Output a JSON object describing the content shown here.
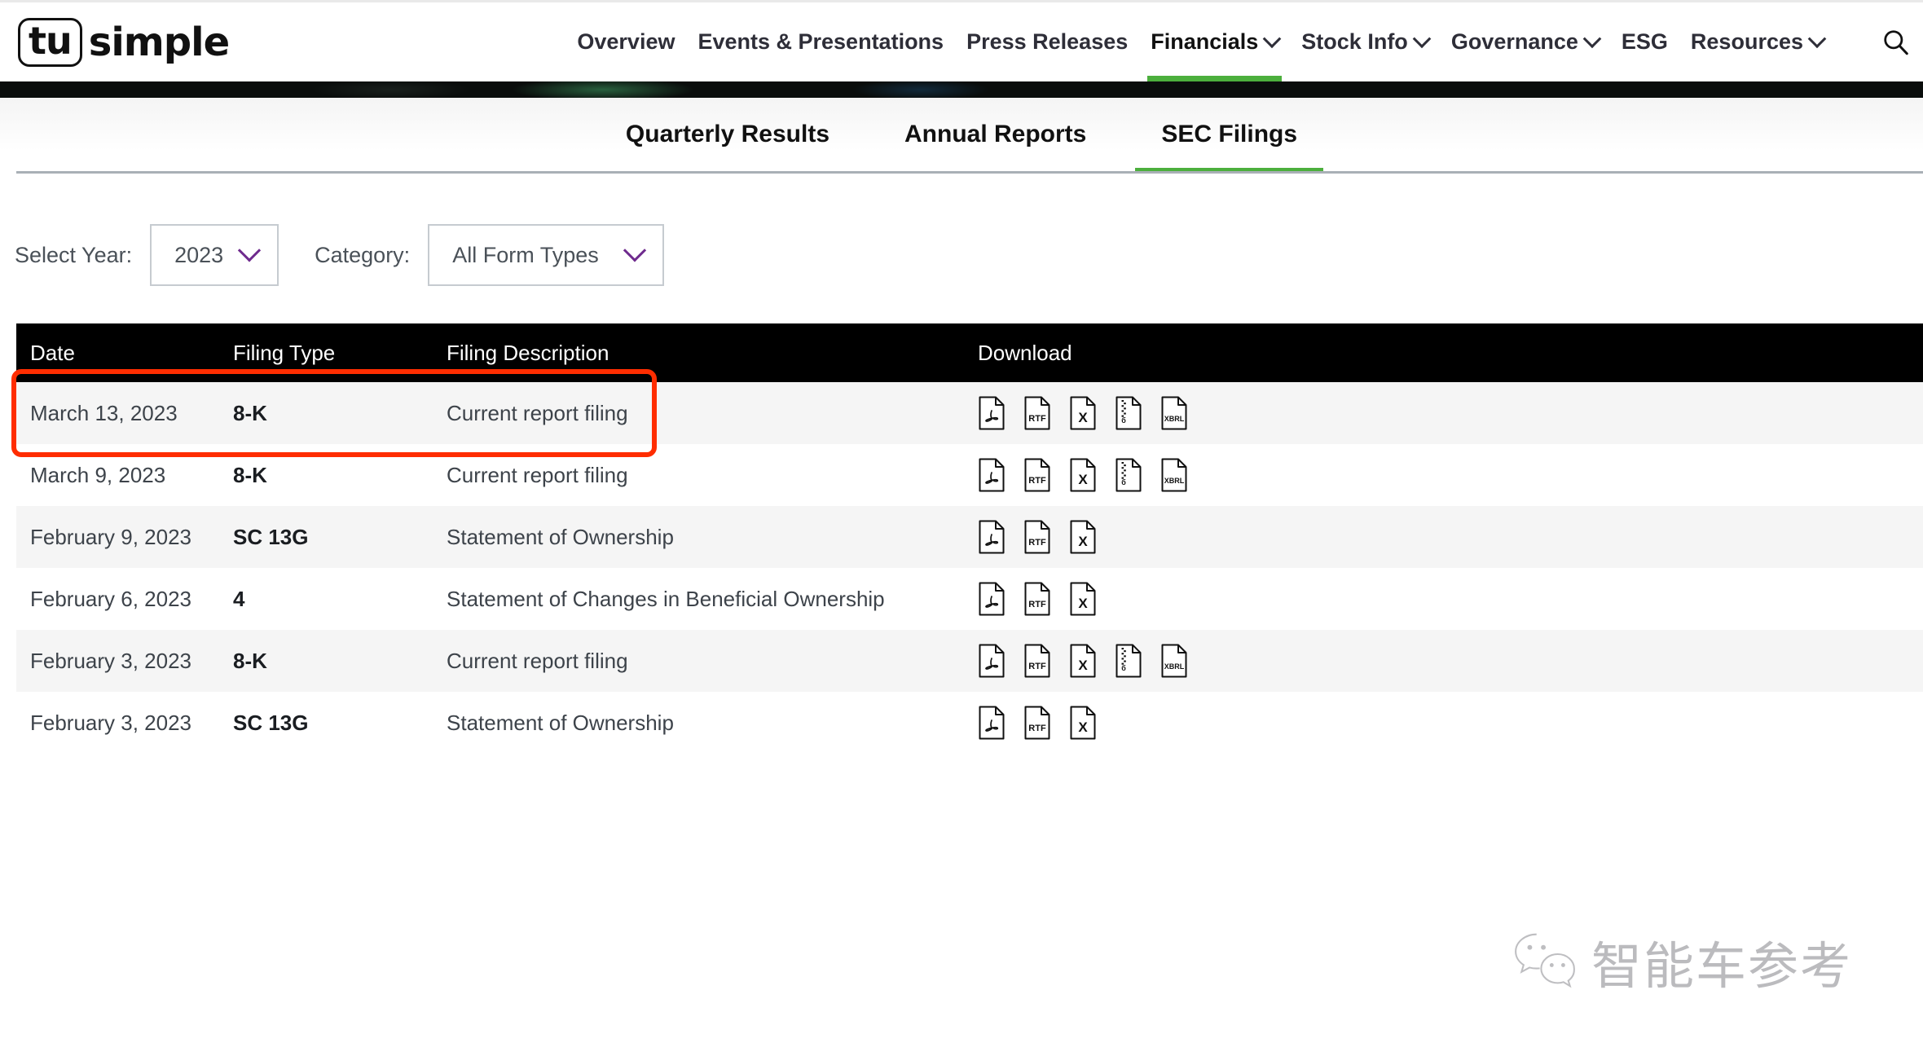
{
  "brand": {
    "logo_box_text": "tu",
    "logo_word": "simple"
  },
  "nav": {
    "items": [
      {
        "label": "Overview",
        "chevron": false,
        "active": false
      },
      {
        "label": "Events & Presentations",
        "chevron": false,
        "active": false
      },
      {
        "label": "Press Releases",
        "chevron": false,
        "active": false
      },
      {
        "label": "Financials",
        "chevron": true,
        "active": true
      },
      {
        "label": "Stock Info",
        "chevron": true,
        "active": false
      },
      {
        "label": "Governance",
        "chevron": true,
        "active": false
      },
      {
        "label": "ESG",
        "chevron": false,
        "active": false
      },
      {
        "label": "Resources",
        "chevron": true,
        "active": false
      }
    ],
    "search_icon": "search-icon",
    "active_accent": "#4caf3d"
  },
  "subtabs": {
    "items": [
      {
        "label": "Quarterly Results",
        "active": false
      },
      {
        "label": "Annual Reports",
        "active": false
      },
      {
        "label": "SEC Filings",
        "active": true
      }
    ]
  },
  "filters": {
    "year_label": "Select Year:",
    "year_value": "2023",
    "category_label": "Category:",
    "category_value": "All Form Types",
    "chevron_color": "#6f2b8e"
  },
  "table": {
    "headers": {
      "date": "Date",
      "filing_type": "Filing Type",
      "filing_description": "Filing Description",
      "download": "Download"
    },
    "rows": [
      {
        "date": "March 13, 2023",
        "filing_type": "8-K",
        "filing_description": "Current report filing",
        "downloads": [
          "PDF",
          "RTF",
          "X",
          "ZIP",
          "XBRL"
        ],
        "highlighted": true
      },
      {
        "date": "March 9, 2023",
        "filing_type": "8-K",
        "filing_description": "Current report filing",
        "downloads": [
          "PDF",
          "RTF",
          "X",
          "ZIP",
          "XBRL"
        ],
        "highlighted": false
      },
      {
        "date": "February 9, 2023",
        "filing_type": "SC 13G",
        "filing_description": "Statement of Ownership",
        "downloads": [
          "PDF",
          "RTF",
          "X"
        ],
        "highlighted": false
      },
      {
        "date": "February 6, 2023",
        "filing_type": "4",
        "filing_description": "Statement of Changes in Beneficial Ownership",
        "downloads": [
          "PDF",
          "RTF",
          "X"
        ],
        "highlighted": false
      },
      {
        "date": "February 3, 2023",
        "filing_type": "8-K",
        "filing_description": "Current report filing",
        "downloads": [
          "PDF",
          "RTF",
          "X",
          "ZIP",
          "XBRL"
        ],
        "highlighted": false
      },
      {
        "date": "February 3, 2023",
        "filing_type": "SC 13G",
        "filing_description": "Statement of Ownership",
        "downloads": [
          "PDF",
          "RTF",
          "X"
        ],
        "highlighted": false
      }
    ]
  },
  "annotation": {
    "color": "#ff2d00",
    "target_row_index": 0
  },
  "watermark": {
    "text": "智能车参考",
    "logo": "wechat-logo"
  }
}
